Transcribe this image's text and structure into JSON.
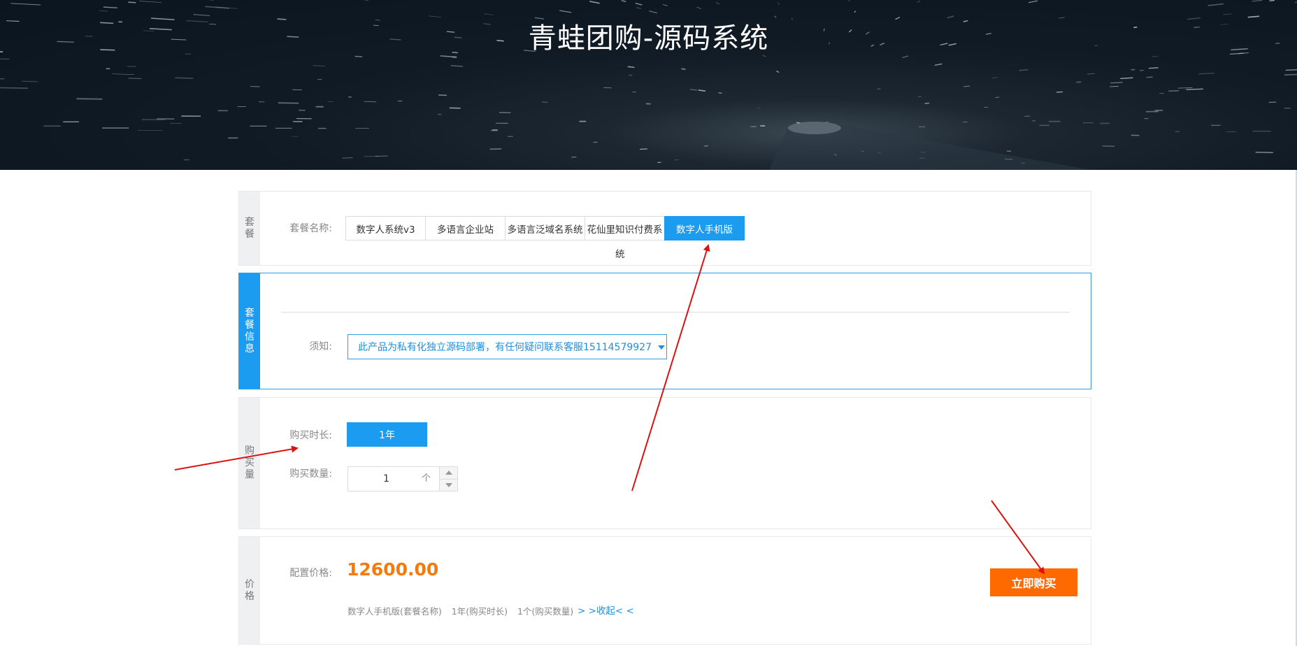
{
  "banner": {
    "title": "青蛙团购-源码系统"
  },
  "package_section": {
    "side_label": "套餐",
    "name_label": "套餐名称:",
    "tabs": [
      {
        "label": "数字人系统v3",
        "selected": false
      },
      {
        "label": "多语言企业站",
        "selected": false
      },
      {
        "label": "多语言泛域名系统",
        "selected": false
      },
      {
        "label": "花仙里知识付费系",
        "selected": false
      },
      {
        "label": "数字人手机版",
        "selected": true
      }
    ],
    "wrapped_text": "统"
  },
  "info_section": {
    "side_label": "套餐信息",
    "notice_label": "须知:",
    "notice_value": "此产品为私有化独立源码部署，有任何疑问联系客服15114579927"
  },
  "purchase_section": {
    "side_label": "购买量",
    "duration_label": "购买时长:",
    "duration_option": "1年",
    "quantity_label": "购买数量:",
    "quantity_value": "1",
    "quantity_unit": "个"
  },
  "price_section": {
    "side_label": "价格",
    "price_label": "配置价格:",
    "price_value": "12600.00",
    "summary": {
      "package": "数字人手机版(套餐名称)",
      "duration": "1年(购买时长)",
      "quantity": "1个(购买数量)"
    },
    "collapse_link": "> >收起< <",
    "buy_button": "立即购买"
  },
  "colors": {
    "accent": "#1b9cf0",
    "price": "#f57a0a",
    "buy_button": "#ff6a00",
    "annotation_arrow": "#dd1111"
  }
}
